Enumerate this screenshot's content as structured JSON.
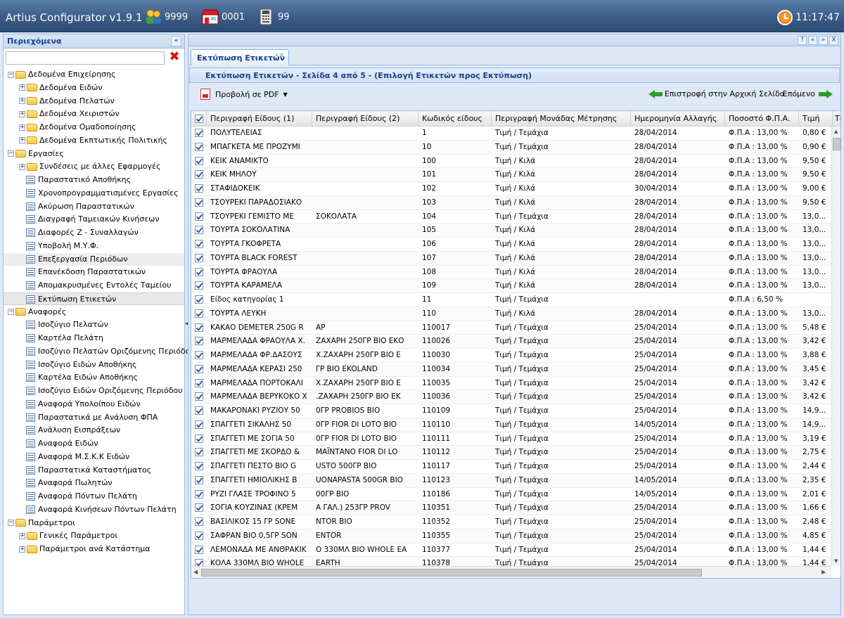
{
  "app": {
    "title": "Artius Configurator v1.9.1  -",
    "users_count": "9999",
    "store_code": "0001",
    "register_code": "99",
    "clock": "11:17:47"
  },
  "sidebar": {
    "title": "Περιεχόμενα",
    "collapse": "«",
    "filter_value": "",
    "items": [
      {
        "label": "Δεδομένα Επιχείρησης",
        "type": "folder",
        "level": 0,
        "toggle": "−"
      },
      {
        "label": "Δεδομένα Ειδών",
        "type": "folder",
        "level": 1,
        "toggle": "+"
      },
      {
        "label": "Δεδομένα Πελατών",
        "type": "folder",
        "level": 1,
        "toggle": "+"
      },
      {
        "label": "Δεδομένα Χειριστών",
        "type": "folder",
        "level": 1,
        "toggle": "+"
      },
      {
        "label": "Δεδομένα Ομαδοποίησης",
        "type": "folder",
        "level": 1,
        "toggle": "+"
      },
      {
        "label": "Δεδομένα Εκπτωτικής Πολιτικής",
        "type": "folder",
        "level": 1,
        "toggle": "+"
      },
      {
        "label": "Εργασίες",
        "type": "folder",
        "level": 0,
        "toggle": "−"
      },
      {
        "label": "Συνδέσεις με άλλες Εφαρμογές",
        "type": "folder",
        "level": 1,
        "toggle": "+"
      },
      {
        "label": "Παραστατικό Αποθήκης",
        "type": "leaf",
        "level": 1
      },
      {
        "label": "Χρονοπρογραμματισμένες Εργασίες",
        "type": "leaf",
        "level": 1
      },
      {
        "label": "Ακύρωση Παραστατικών",
        "type": "leaf",
        "level": 1
      },
      {
        "label": "Διαγραφή Ταμειακών Κινήσεων",
        "type": "leaf",
        "level": 1
      },
      {
        "label": "Διαφορές Ζ - Συναλλαγών",
        "type": "leaf",
        "level": 1
      },
      {
        "label": "Υποβολή Μ.Υ.Φ.",
        "type": "leaf",
        "level": 1
      },
      {
        "label": "Επεξεργασία Περιόδων",
        "type": "leaf",
        "level": 1,
        "state": "hover"
      },
      {
        "label": "Επανέκδοση Παραστατικών",
        "type": "leaf",
        "level": 1
      },
      {
        "label": "Απομακρυσμένες Εντολές Ταμείου",
        "type": "leaf",
        "level": 1
      },
      {
        "label": "Εκτύπωση Ετικετών",
        "type": "leaf",
        "level": 1,
        "state": "selected"
      },
      {
        "label": "Αναφορές",
        "type": "folder",
        "level": 0,
        "toggle": "−"
      },
      {
        "label": "Ισοζύγιο Πελατών",
        "type": "leaf",
        "level": 1
      },
      {
        "label": "Καρτέλα Πελάτη",
        "type": "leaf",
        "level": 1
      },
      {
        "label": "Ισοζύγιο Πελατών Οριζόμενης Περιόδου",
        "type": "leaf",
        "level": 1
      },
      {
        "label": "Ισοζύγιο Ειδών Αποθήκης",
        "type": "leaf",
        "level": 1
      },
      {
        "label": "Καρτέλα Ειδών Αποθήκης",
        "type": "leaf",
        "level": 1
      },
      {
        "label": "Ισοζύγιο Ειδών Οριζόμενης Περιόδου",
        "type": "leaf",
        "level": 1
      },
      {
        "label": "Αναφορά Υπολοίπου Ειδών",
        "type": "leaf",
        "level": 1
      },
      {
        "label": "Παραστατικά με Ανάλυση ΦΠΑ",
        "type": "leaf",
        "level": 1
      },
      {
        "label": "Ανάλυση Εισπράξεων",
        "type": "leaf",
        "level": 1
      },
      {
        "label": "Αναφορά Ειδών",
        "type": "leaf",
        "level": 1
      },
      {
        "label": "Αναφορά Μ.Σ.Κ.Κ Ειδών",
        "type": "leaf",
        "level": 1
      },
      {
        "label": "Παραστατικά Καταστήματος",
        "type": "leaf",
        "level": 1
      },
      {
        "label": "Αναφορά Πωλητών",
        "type": "leaf",
        "level": 1
      },
      {
        "label": "Αναφορά Πόντων Πελάτη",
        "type": "leaf",
        "level": 1
      },
      {
        "label": "Αναφορά Κινήσεων Πόντων Πελάτη",
        "type": "leaf",
        "level": 1
      },
      {
        "label": "Παράμετροι",
        "type": "folder",
        "level": 0,
        "toggle": "−"
      },
      {
        "label": "Γενικές Παράμετροι",
        "type": "folder",
        "level": 1,
        "toggle": "+"
      },
      {
        "label": "Παράμετροι ανά Κατάστημα",
        "type": "folder",
        "level": 1,
        "toggle": "+"
      }
    ]
  },
  "main": {
    "tab_label": "Εκτύπωση Ετικετών",
    "tab_close": "×",
    "panel_tools": [
      "?",
      "«",
      "»",
      "X"
    ],
    "inner_title": "Εκτύπωση Ετικετών - Σελίδα 4 από 5 - (Επιλογή Ετικετών προς Εκτύπωση)",
    "pdf_label": "Προβολή σε PDF",
    "back_label": "Επιστροφή στην Αρχική Σελίδα",
    "next_label": "Επόμενο"
  },
  "grid": {
    "columns": [
      "Περιγραφή Είδους (1)",
      "Περιγραφή Είδους (2)",
      "Κωδικός είδους",
      "Περιγραφή Μονάδας Μέτρησης",
      "Ημερομηνία Αλλαγής",
      "Ποσοστό Φ.Π.Α.",
      "Τιμή",
      "Τιμ"
    ],
    "rows": [
      [
        "ΠΟΛΥΤΕΛΕΙΑΣ",
        "",
        "1",
        "Τιμή / Τεμάχια",
        "28/04/2014",
        "Φ.Π.Α : 13,00 %",
        "0,80 €"
      ],
      [
        "ΜΠΑΓΚΕΤΑ ΜΕ ΠΡΟΖΥΜΙ",
        "",
        "10",
        "Τιμή / Τεμάχια",
        "28/04/2014",
        "Φ.Π.Α : 13,00 %",
        "0,90 €"
      ],
      [
        "ΚΕΙΚ ΑΝΑΜΙΚΤΟ",
        "",
        "100",
        "Τιμή / Κιλά",
        "28/04/2014",
        "Φ.Π.Α : 13,00 %",
        "9,50 €"
      ],
      [
        "ΚΕΙΚ ΜΗΛΟΥ",
        "",
        "101",
        "Τιμή / Κιλά",
        "28/04/2014",
        "Φ.Π.Α : 13,00 %",
        "9,50 €"
      ],
      [
        "ΣΤΑΦΙΔΟΚΕΙΚ",
        "",
        "102",
        "Τιμή / Κιλά",
        "30/04/2014",
        "Φ.Π.Α : 13,00 %",
        "9,00 €"
      ],
      [
        "ΤΣΟΥΡΕΚΙ ΠΑΡΑΔΟΣΙΑΚΟ",
        "",
        "103",
        "Τιμή / Κιλά",
        "28/04/2014",
        "Φ.Π.Α : 13,00 %",
        "9,50 €"
      ],
      [
        "ΤΣΟΥΡΕΚΙ ΓΕΜΙΣΤΟ ΜΕ",
        "ΣΟΚΟΛΑΤΑ",
        "104",
        "Τιμή / Τεμάχια",
        "28/04/2014",
        "Φ.Π.Α : 13,00 %",
        "13,0..."
      ],
      [
        "ΤΟΥΡΤΑ ΣΟΚΟΛΑΤΙΝΑ",
        "",
        "105",
        "Τιμή / Κιλά",
        "28/04/2014",
        "Φ.Π.Α : 13,00 %",
        "13,0..."
      ],
      [
        "ΤΟΥΡΤΑ ΓΚΟΦΡΕΤΑ",
        "",
        "106",
        "Τιμή / Κιλά",
        "28/04/2014",
        "Φ.Π.Α : 13,00 %",
        "13,0..."
      ],
      [
        "ΤΟΥΡΤΑ BLACK FOREST",
        "",
        "107",
        "Τιμή / Κιλά",
        "28/04/2014",
        "Φ.Π.Α : 13,00 %",
        "13,0..."
      ],
      [
        "ΤΟΥΡΤΑ ΦΡΑΟΥΛΑ",
        "",
        "108",
        "Τιμή / Κιλά",
        "28/04/2014",
        "Φ.Π.Α : 13,00 %",
        "13,0..."
      ],
      [
        "ΤΟΥΡΤΑ ΚΑΡΑΜΕΛΑ",
        "",
        "109",
        "Τιμή / Κιλά",
        "28/04/2014",
        "Φ.Π.Α : 13,00 %",
        "13,0..."
      ],
      [
        "Είδος κατηγορίας 1",
        "",
        "11",
        "Τιμή / Τεμάχια",
        "",
        "Φ.Π.Α : 6,50 %",
        ""
      ],
      [
        "ΤΟΥΡΤΑ ΛΕΥΚΗ",
        "",
        "110",
        "Τιμή / Κιλά",
        "28/04/2014",
        "Φ.Π.Α : 13,00 %",
        "13,0..."
      ],
      [
        "ΚΑΚΑΟ DEMETER 250G R",
        "ΑΡ",
        "110017",
        "Τιμή / Τεμάχια",
        "25/04/2014",
        "Φ.Π.Α : 13,00 %",
        "5,48 €"
      ],
      [
        "ΜΑΡΜΕΛΑΔΑ ΦΡΑΟΥΛΑ Χ.",
        "ΖΑΧΑΡΗ 250ΓΡ ΒΙΟ ΕΚΟ",
        "110026",
        "Τιμή / Τεμάχια",
        "25/04/2014",
        "Φ.Π.Α : 13,00 %",
        "3,42 €"
      ],
      [
        "ΜΑΡΜΕΛΑΔΑ ΦΡ.ΔΑΣΟΥΣ",
        "Χ.ΖΑΧΑΡΗ 250ΓΡ ΒΙΟ Ε",
        "110030",
        "Τιμή / Τεμάχια",
        "25/04/2014",
        "Φ.Π.Α : 13,00 %",
        "3,88 €"
      ],
      [
        "ΜΑΡΜΕΛΑΔΑ ΚΕΡΑΣΙ 250",
        "ΓΡ ΒΙΟ EKOLAND",
        "110034",
        "Τιμή / Τεμάχια",
        "25/04/2014",
        "Φ.Π.Α : 13,00 %",
        "3,45 €"
      ],
      [
        "ΜΑΡΜΕΛΑΔΑ ΠΟΡΤΟΚΑΛΙ",
        "Χ.ΖΑΧΑΡΗ 250ΓΡ ΒΙΟ Ε",
        "110035",
        "Τιμή / Τεμάχια",
        "25/04/2014",
        "Φ.Π.Α : 13,00 %",
        "3,42 €"
      ],
      [
        "ΜΑΡΜΕΛΑΔΑ ΒΕΡΥΚΟΚΟ Χ",
        ".ΖΑΧΑΡΗ 250ΓΡ ΒΙΟ ΕΚ",
        "110036",
        "Τιμή / Τεμάχια",
        "25/04/2014",
        "Φ.Π.Α : 13,00 %",
        "3,42 €"
      ],
      [
        "ΜΑΚΑΡΟΝΑΚΙ ΡΥΖΙΟΥ 50",
        "0ΓΡ PROBIOS ΒΙΟ",
        "110109",
        "Τιμή / Τεμάχια",
        "25/04/2014",
        "Φ.Π.Α : 13,00 %",
        "14,9..."
      ],
      [
        "ΣΠΑΓΓΕΤΙ ΣΙΚΑΛΗΣ 50",
        "0ΓΡ FIOR DI LOTO ΒΙΟ",
        "110110",
        "Τιμή / Τεμάχια",
        "14/05/2014",
        "Φ.Π.Α : 13,00 %",
        "14,9..."
      ],
      [
        "ΣΠΑΓΓΕΤΙ ΜΕ ΣΟΓΙΑ 50",
        "0ΓΡ FIOR DI LOTO ΒΙΟ",
        "110111",
        "Τιμή / Τεμάχια",
        "25/04/2014",
        "Φ.Π.Α : 13,00 %",
        "3,19 €"
      ],
      [
        "ΣΠΑΓΓΕΤΙ ΜΕ ΣΚΟΡΔΟ &",
        "ΜΑΪΝΤΑΝΟ FIOR DI LO",
        "110112",
        "Τιμή / Τεμάχια",
        "25/04/2014",
        "Φ.Π.Α : 13,00 %",
        "2,75 €"
      ],
      [
        "ΣΠΑΓΓΕΤΙ ΠΕΣΤΟ ΒΙΟ G",
        "USTO 500ΓΡ ΒΙΟ",
        "110117",
        "Τιμή / Τεμάχια",
        "25/04/2014",
        "Φ.Π.Α : 13,00 %",
        "2,44 €"
      ],
      [
        "ΣΠΑΓΓΕΤΙ ΗΜΙΟΛΙΚΗΣ Β",
        "UONAPASTA 500GR ΒΙΟ",
        "110123",
        "Τιμή / Τεμάχια",
        "14/05/2014",
        "Φ.Π.Α : 13,00 %",
        "2,35 €"
      ],
      [
        "ΡΥΖΙ ΓΛΑΣΕ ΤΡΟΦΙΝΟ 5",
        "00ΓΡ ΒΙΟ",
        "110186",
        "Τιμή / Τεμάχια",
        "14/05/2014",
        "Φ.Π.Α : 13,00 %",
        "2,01 €"
      ],
      [
        "ΣΟΓΙΑ ΚΟΥΖΙΝΑΣ (ΚΡΕΜ",
        "Α ΓΑΛ.) 253ΓΡ PROV",
        "110351",
        "Τιμή / Τεμάχια",
        "25/04/2014",
        "Φ.Π.Α : 13,00 %",
        "1,66 €"
      ],
      [
        "ΒΑΣΙΛΙΚΟΣ 15 ΓΡ SONE",
        "NTOR ΒΙΟ",
        "110352",
        "Τιμή / Τεμάχια",
        "25/04/2014",
        "Φ.Π.Α : 13,00 %",
        "2,48 €"
      ],
      [
        "ΣΑΦΡΑΝ ΒΙΟ 0,5ΓΡ SON",
        "ENTOR",
        "110355",
        "Τιμή / Τεμάχια",
        "25/04/2014",
        "Φ.Π.Α : 13,00 %",
        "4,85 €"
      ],
      [
        "ΛΕΜΟΝΑΔΑ ΜΕ ΑΝΘΡΑΚΙΚ",
        "Ο 330ΜΛ ΒΙΟ WHOLE EA",
        "110377",
        "Τιμή / Τεμάχια",
        "25/04/2014",
        "Φ.Π.Α : 13,00 %",
        "1,44 €"
      ],
      [
        "ΚΟΛΑ 330ΜΛ ΒΙΟ WHOLE",
        "EARTH",
        "110378",
        "Τιμή / Τεμάχια",
        "25/04/2014",
        "Φ.Π.Α : 13,00 %",
        "1,44 €"
      ]
    ]
  }
}
